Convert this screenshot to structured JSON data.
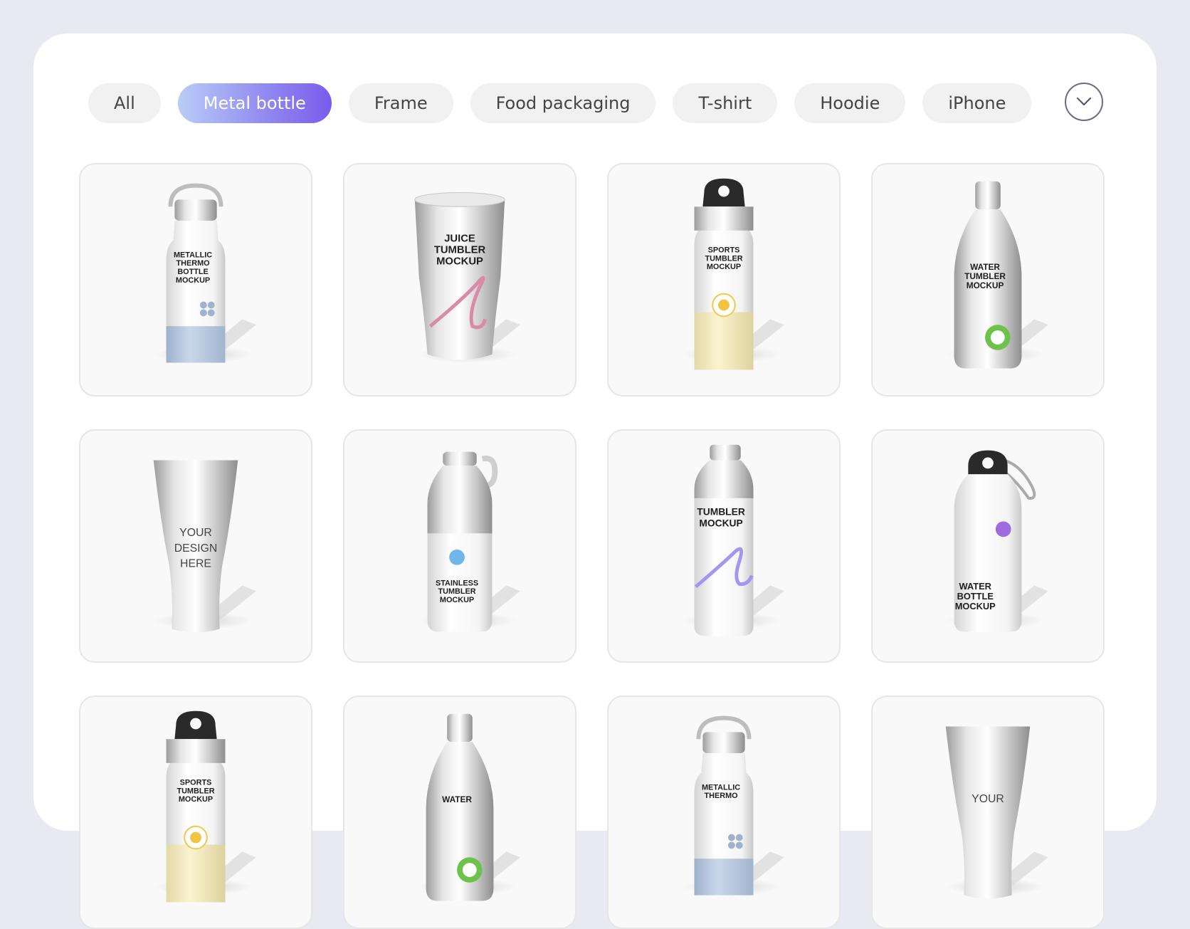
{
  "filters": {
    "chips": [
      {
        "label": "All",
        "active": false
      },
      {
        "label": "Metal bottle",
        "active": true
      },
      {
        "label": "Frame",
        "active": false
      },
      {
        "label": "Food packaging",
        "active": false
      },
      {
        "label": "T-shirt",
        "active": false
      },
      {
        "label": "Hoodie",
        "active": false
      },
      {
        "label": "iPhone",
        "active": false
      }
    ],
    "expand_icon": "chevron-down-icon"
  },
  "products": [
    {
      "lines": [
        "METALLIC",
        "THERMO",
        "BOTTLE",
        "MOCKUP"
      ],
      "kind": "thermo-bottle"
    },
    {
      "lines": [
        "JUICE",
        "TUMBLER",
        "MOCKUP"
      ],
      "kind": "juice-tumbler"
    },
    {
      "lines": [
        "SPORTS",
        "TUMBLER",
        "MOCKUP"
      ],
      "kind": "sports-bottle"
    },
    {
      "lines": [
        "WATER",
        "TUMBLER",
        "MOCKUP"
      ],
      "kind": "water-tumbler"
    },
    {
      "lines": [
        "YOUR",
        "DESIGN",
        "HERE"
      ],
      "kind": "tall-tumbler"
    },
    {
      "lines": [
        "STAINLESS",
        "TUMBLER",
        "MOCKUP"
      ],
      "kind": "stainless-tumbler"
    },
    {
      "lines": [
        "TUMBLER",
        "MOCKUP"
      ],
      "kind": "tumbler"
    },
    {
      "lines": [
        "WATER",
        "BOTTLE",
        "MOCKUP"
      ],
      "kind": "carabiner-bottle"
    },
    {
      "lines": [
        "SPORTS",
        "TUMBLER",
        "MOCKUP"
      ],
      "kind": "sports-bottle"
    },
    {
      "lines": [
        "WATER"
      ],
      "kind": "water-tumbler"
    },
    {
      "lines": [
        "METALLIC",
        "THERMO"
      ],
      "kind": "thermo-bottle"
    },
    {
      "lines": [
        "YOUR"
      ],
      "kind": "tall-tumbler"
    }
  ],
  "colors": {
    "accent_gradient_start": "#b8cdf7",
    "accent_gradient_end": "#7a5cec",
    "chip_bg": "#f1f1f1",
    "page_bg": "#e9e9f2"
  }
}
